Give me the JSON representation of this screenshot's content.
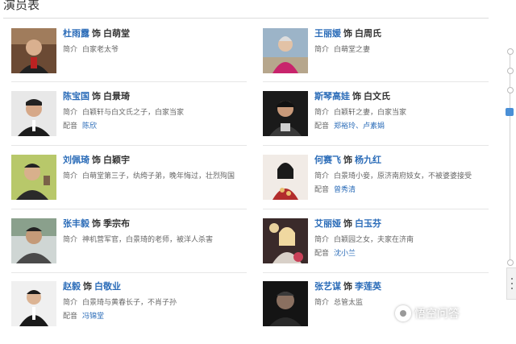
{
  "section_title": "演员表",
  "cast": [
    {
      "actor": "杜雨露",
      "as": "饰",
      "role": "白萌堂",
      "role_link": false,
      "intro_label": "简介",
      "intro": "白家老太爷",
      "voice_label": "",
      "voice": ""
    },
    {
      "actor": "王丽媛",
      "as": "饰",
      "role": "白周氏",
      "role_link": false,
      "intro_label": "简介",
      "intro": "白萌堂之妻",
      "voice_label": "",
      "voice": ""
    },
    {
      "actor": "陈宝国",
      "as": "饰",
      "role": "白景琦",
      "role_link": false,
      "intro_label": "简介",
      "intro": "白颖轩与白文氏之子，白家当家",
      "voice_label": "配音",
      "voice": "陈欣"
    },
    {
      "actor": "斯琴高娃",
      "as": "饰",
      "role": "白文氏",
      "role_link": false,
      "intro_label": "简介",
      "intro": "白颖轩之妻，白家当家",
      "voice_label": "配音",
      "voice": "郑裕玲、卢素娟"
    },
    {
      "actor": "刘佩琦",
      "as": "饰",
      "role": "白颖宇",
      "role_link": false,
      "intro_label": "简介",
      "intro": "白萌堂第三子，纨绔子弟，晚年悔过，壮烈殉国",
      "voice_label": "",
      "voice": ""
    },
    {
      "actor": "何赛飞",
      "as": "饰",
      "role": "杨九红",
      "role_link": true,
      "intro_label": "简介",
      "intro": "白景琦小妾，原济南府妓女，不被婆婆接受",
      "voice_label": "配音",
      "voice": "曾秀清"
    },
    {
      "actor": "张丰毅",
      "as": "饰",
      "role": "季宗布",
      "role_link": false,
      "intro_label": "简介",
      "intro": "神机营军官，白景琦的老师，被洋人杀害",
      "voice_label": "",
      "voice": ""
    },
    {
      "actor": "艾丽娅",
      "as": "饰",
      "role": "白玉芬",
      "role_link": true,
      "intro_label": "简介",
      "intro": "白颖园之女，夫家在济南",
      "voice_label": "配音",
      "voice": "沈小兰"
    },
    {
      "actor": "赵毅",
      "as": "饰",
      "role": "白敬业",
      "role_link": true,
      "intro_label": "简介",
      "intro": "白景琦与黄春长子，不肖子孙",
      "voice_label": "配音",
      "voice": "冯锦堂"
    },
    {
      "actor": "张艺谋",
      "as": "饰",
      "role": "李莲英",
      "role_link": true,
      "intro_label": "简介",
      "intro": "总管太监",
      "voice_label": "",
      "voice": ""
    }
  ],
  "watermark": "悟空问答",
  "colors": {
    "link": "#2b6cb8",
    "text": "#333333",
    "muted": "#666666",
    "accent": "#4a8fd6"
  }
}
